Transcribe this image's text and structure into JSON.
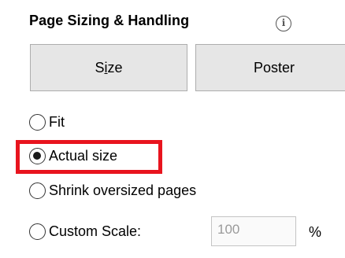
{
  "section": {
    "title": "Page Sizing & Handling",
    "info_icon": "info-icon"
  },
  "buttons": {
    "size": {
      "prefix": "S",
      "mnemonic": "i",
      "suffix": "ze"
    },
    "poster": "Poster"
  },
  "options": {
    "fit": "Fit",
    "actual_size": "Actual size",
    "shrink": "Shrink oversized pages",
    "custom_scale": "Custom Scale:"
  },
  "selected_option": "actual_size",
  "custom_scale_value": "100",
  "percent_sign": "%",
  "colors": {
    "highlight": "#e8141e",
    "button_bg": "#e6e6e6"
  }
}
